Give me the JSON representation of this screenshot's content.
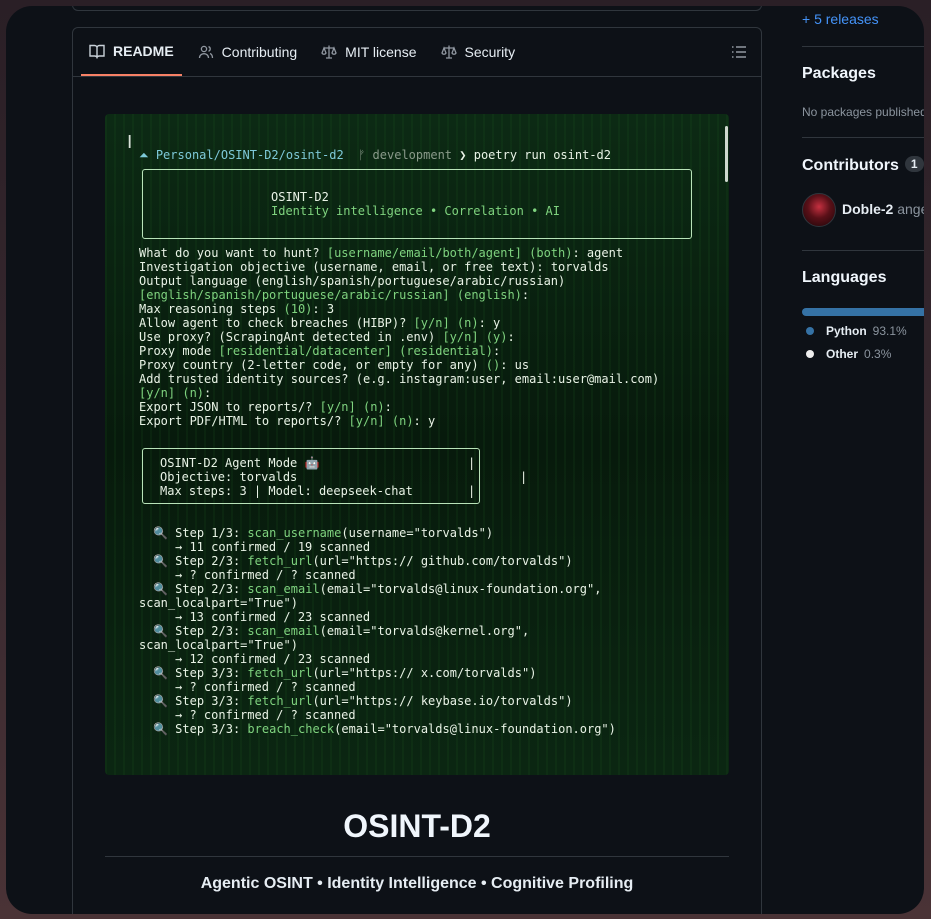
{
  "readme_tabs": [
    {
      "label": "README",
      "icon": "book-icon",
      "active": true
    },
    {
      "label": "Contributing",
      "icon": "people-icon"
    },
    {
      "label": "MIT license",
      "icon": "law-icon"
    },
    {
      "label": "Security",
      "icon": "law-icon"
    }
  ],
  "terminal": {
    "prompt_path": "Personal/OSINT-D2/osint-d2",
    "branch": "development",
    "command": "poetry run osint-d2",
    "banner_title": "OSINT-D2",
    "banner_tagline": "Identity intelligence • Correlation • AI",
    "questions": [
      {
        "q": "What do you want to hunt? ",
        "opt": "[username/email/both/agent] (both)",
        "ans": ": agent"
      },
      {
        "q": "Investigation objective (username, email, or free text): ",
        "opt": "",
        "ans": "torvalds"
      },
      {
        "q": "Output language (english/spanish/portuguese/arabic/russian)",
        "opt": "",
        "ans": ""
      },
      {
        "q": "",
        "opt": "[english/spanish/portuguese/arabic/russian] (english)",
        "ans": ":"
      },
      {
        "q": "Max reasoning steps ",
        "opt": "(10)",
        "ans": ": 3"
      },
      {
        "q": "Allow agent to check breaches (HIBP)? ",
        "opt": "[y/n] (n)",
        "ans": ": y"
      },
      {
        "q": "Use proxy? (ScrapingAnt detected in .env) ",
        "opt": "[y/n] (y)",
        "ans": ":"
      },
      {
        "q": "Proxy mode ",
        "opt": "[residential/datacenter] (residential)",
        "ans": ":"
      },
      {
        "q": "Proxy country (2-letter code, or empty for any) ",
        "opt": "()",
        "ans": ": us"
      },
      {
        "q": "Add trusted identity sources? (e.g. instagram:user, email:user@mail.com)",
        "opt": "",
        "ans": ""
      },
      {
        "q": "",
        "opt": "[y/n] (n)",
        "ans": ":"
      },
      {
        "q": "Export JSON to reports/? ",
        "opt": "[y/n] (n)",
        "ans": ":"
      },
      {
        "q": "Export PDF/HTML to reports/? ",
        "opt": "[y/n] (n)",
        "ans": ": y"
      }
    ],
    "agent_box": {
      "title": "OSINT-D2 Agent Mode 🤖",
      "objective": "Objective: torvalds",
      "steps_model": "Max steps: 3 | Model: deepseek-chat"
    },
    "steps": [
      {
        "label": "Step 1/3: ",
        "fn": "scan_username",
        "args": "(username=\"torvalds\")",
        "result": "→ 11 confirmed / 19 scanned"
      },
      {
        "label": "Step 2/3: ",
        "fn": "fetch_url",
        "args": "(url=\"https:// github.com/torvalds\")",
        "result": "→ ? confirmed / ? scanned"
      },
      {
        "label": "Step 2/3: ",
        "fn": "scan_email",
        "args": "(email=\"torvalds@linux-foundation.org\",",
        "cont": "scan_localpart=\"True\")",
        "result": "→ 13 confirmed / 23 scanned"
      },
      {
        "label": "Step 2/3: ",
        "fn": "scan_email",
        "args": "(email=\"torvalds@kernel.org\",",
        "cont": "scan_localpart=\"True\")",
        "result": "→ 12 confirmed / 23 scanned"
      },
      {
        "label": "Step 3/3: ",
        "fn": "fetch_url",
        "args": "(url=\"https:// x.com/torvalds\")",
        "result": "→ ? confirmed / ? scanned"
      },
      {
        "label": "Step 3/3: ",
        "fn": "fetch_url",
        "args": "(url=\"https:// keybase.io/torvalds\")",
        "result": "→ ? confirmed / ? scanned"
      },
      {
        "label": "Step 3/3: ",
        "fn": "breach_check",
        "args": "(email=\"torvalds@linux-foundation.org\")",
        "result": ""
      }
    ]
  },
  "readme_title": "OSINT-D2",
  "readme_subtitle": "Agentic OSINT • Identity Intelligence • Cognitive Profiling",
  "sidebar": {
    "releases_link": "+ 5 releases",
    "packages_heading": "Packages",
    "packages_empty": "No packages published",
    "contributors_heading": "Contributors",
    "contributors_count": "1",
    "contributor_name": "Doble-2",
    "contributor_extra": "ange",
    "languages_heading": "Languages",
    "languages": [
      {
        "name": "Python",
        "percent": "93.1%",
        "color": "#3572A5"
      },
      {
        "name": "Other",
        "percent": "0.3%",
        "color": "#ededed"
      }
    ]
  },
  "colors": {
    "accent_underline": "#f78166",
    "link": "#4493f8",
    "terminal_green": "#7fd37f"
  }
}
